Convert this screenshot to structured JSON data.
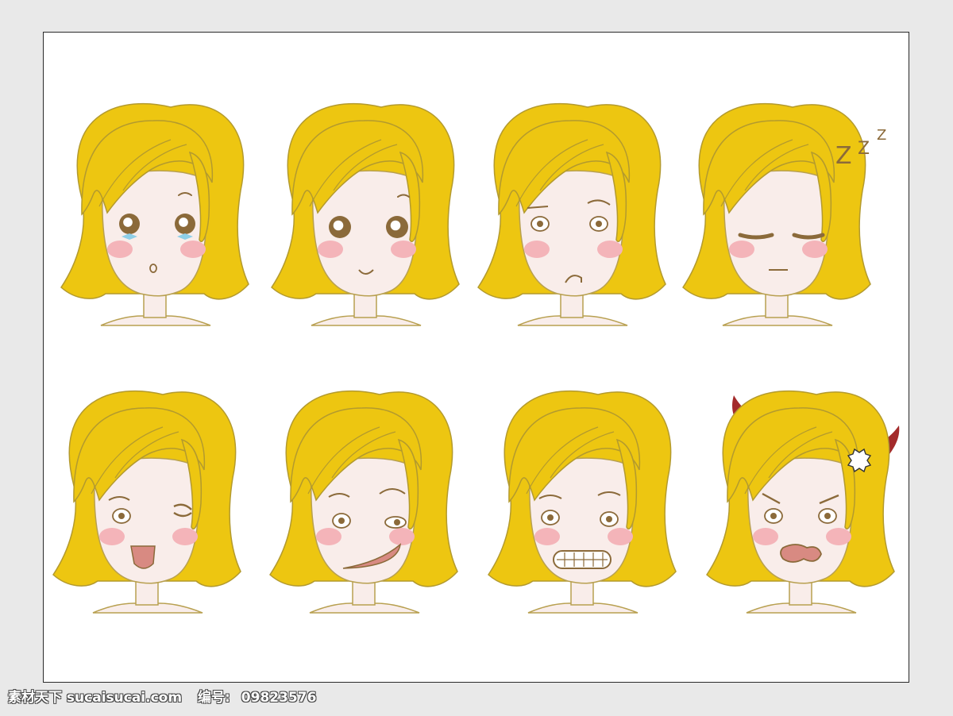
{
  "colors": {
    "hair": "#EDC611",
    "hair_outline": "#B39A2E",
    "skin": "#F9EDEA",
    "skin_outline": "#B8A050",
    "blush": "#F4B4B9",
    "eye": "#8B6A3A",
    "mouth_fill": "#D88A82",
    "horn": "#A32A2A",
    "tear": "#8ECFE8",
    "frame_border": "#2A2A2A",
    "page_background": "#E9E9E9"
  },
  "faces": [
    {
      "expression": "surprised-crying"
    },
    {
      "expression": "happy"
    },
    {
      "expression": "unimpressed"
    },
    {
      "expression": "sleepy",
      "snore": "Z Z Z"
    },
    {
      "expression": "tongue-out-wink"
    },
    {
      "expression": "smirk"
    },
    {
      "expression": "nervous-grin"
    },
    {
      "expression": "angry-devil"
    }
  ],
  "watermark": {
    "site": "素材天下 sucaisucai.com",
    "id_label": "编号:",
    "id": "09823576"
  }
}
